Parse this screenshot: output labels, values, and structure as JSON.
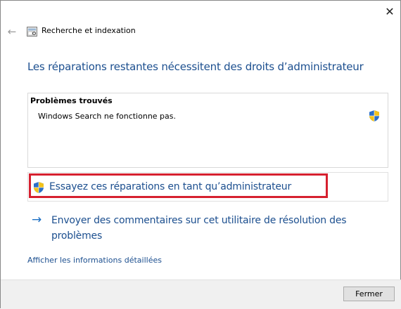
{
  "window": {
    "close_glyph": "✕"
  },
  "header": {
    "back_glyph": "←",
    "app_title": "Recherche et indexation"
  },
  "main": {
    "title": "Les réparations restantes nécessitent des droits d’administrateur",
    "problems_header": "Problèmes trouvés",
    "problems": [
      {
        "text": "Windows Search ne fonctionne pas.",
        "icon": "shield-icon"
      }
    ],
    "admin_fix_label": "Essayez ces réparations en tant qu’administrateur",
    "feedback_arrow": "→",
    "feedback_label": "Envoyer des commentaires sur cet utilitaire de résolution des problèmes",
    "details_link": "Afficher les informations détaillées"
  },
  "footer": {
    "close_label": "Fermer"
  },
  "colors": {
    "link_blue": "#1c4f8f",
    "highlight_red": "#d6202f",
    "footer_bg": "#f0f0f0"
  }
}
